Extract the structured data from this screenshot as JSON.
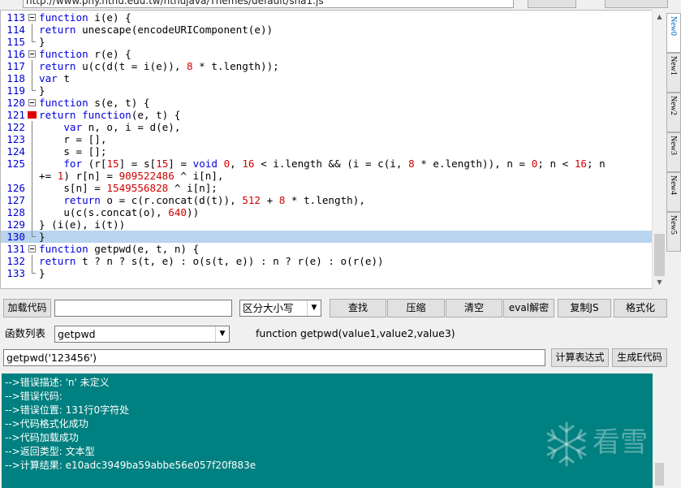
{
  "top": {
    "url": "http://www.phy.ntnu.edu.tw/ntnujava/Themes/default/sha1.js"
  },
  "editor": {
    "lines": [
      {
        "n": "113",
        "fold": "box",
        "html": "<span class=\"kw\">function</span> i(e) {"
      },
      {
        "n": "114",
        "fold": "line",
        "html": "<span class=\"kw\">return</span> unescape(encodeURIComponent(e))"
      },
      {
        "n": "115",
        "fold": "end",
        "html": "}"
      },
      {
        "n": "116",
        "fold": "box",
        "html": "<span class=\"kw\">function</span> r(e) {"
      },
      {
        "n": "117",
        "fold": "line",
        "html": "<span class=\"kw\">return</span> u(c(d(t = i(e)), <span class=\"num\">8</span> * t.length));"
      },
      {
        "n": "118",
        "fold": "line",
        "html": "<span class=\"kw\">var</span> t"
      },
      {
        "n": "119",
        "fold": "end",
        "html": "}"
      },
      {
        "n": "120",
        "fold": "box",
        "html": "<span class=\"kw\">function</span> s(e, t) {"
      },
      {
        "n": "121",
        "fold": "bookmark",
        "html": "<span class=\"kw\">return function</span>(e, t) {"
      },
      {
        "n": "122",
        "fold": "line",
        "html": "    <span class=\"kw\">var</span> n, o, i = d(e),"
      },
      {
        "n": "123",
        "fold": "line",
        "html": "    r = [],"
      },
      {
        "n": "124",
        "fold": "line",
        "html": "    s = [];"
      },
      {
        "n": "125",
        "fold": "line",
        "html": "    <span class=\"kw\">for</span> (r[<span class=\"num\">15</span>] = s[<span class=\"num\">15</span>] = <span class=\"kw\">void</span> <span class=\"num\">0</span>, <span class=\"num\">16</span> &lt; i.length &amp;&amp; (i = c(i, <span class=\"num\">8</span> * e.length)), n = <span class=\"num\">0</span>; n &lt; <span class=\"num\">16</span>; n"
      },
      {
        "n": "",
        "fold": "line",
        "html": "+= <span class=\"num\">1</span>) r[n] = <span class=\"num\">909522486</span> ^ i[n],"
      },
      {
        "n": "126",
        "fold": "line",
        "html": "    s[n] = <span class=\"num\">1549556828</span> ^ i[n];"
      },
      {
        "n": "127",
        "fold": "line",
        "html": "    <span class=\"kw\">return</span> o = c(r.concat(d(t)), <span class=\"num\">512</span> + <span class=\"num\">8</span> * t.length),"
      },
      {
        "n": "128",
        "fold": "line",
        "html": "    u(c(s.concat(o), <span class=\"num\">640</span>))"
      },
      {
        "n": "129",
        "fold": "line",
        "html": "} (i(e), i(t))"
      },
      {
        "n": "130",
        "fold": "end",
        "html": "}",
        "highlight": true
      },
      {
        "n": "131",
        "fold": "box",
        "html": "<span class=\"kw\">function</span> getpwd(e, t, n) {"
      },
      {
        "n": "132",
        "fold": "line",
        "html": "<span class=\"kw\">return</span> t ? n ? s(t, e) : o(s(t, e)) : n ? r(e) : o(r(e))"
      },
      {
        "n": "133",
        "fold": "end",
        "html": "}"
      }
    ]
  },
  "sidetabs": [
    "New0",
    "New1",
    "New2",
    "New3",
    "New4",
    "New5"
  ],
  "toolbar": {
    "load_code_label": "加载代码",
    "load_code_value": "",
    "case_select_value": "区分大小写",
    "find_label": "查找",
    "compress_label": "压缩",
    "clear_label": "清空",
    "eval_decode_label": "eval解密",
    "copy_js_label": "复制JS",
    "format_label": "格式化"
  },
  "functions": {
    "list_label": "函数列表",
    "selected": "getpwd",
    "signature": "function getpwd(value1,value2,value3)"
  },
  "expression": {
    "value": "getpwd('123456')",
    "calc_label": "计算表达式",
    "gen_e_label": "生成E代码"
  },
  "output": {
    "lines": [
      "-->错误描述: 'n' 未定义",
      "-->错误代码:",
      "-->错误位置: 131行0字符处",
      "-->代码格式化成功",
      "-->代码加载成功",
      "-->返回类型: 文本型",
      "-->计算结果: e10adc3949ba59abbe56e057f20f883e"
    ],
    "watermark": "看雪"
  },
  "colors": {
    "output_bg": "#008080",
    "keyword": "#0000e0",
    "number": "#d00000",
    "line_number": "#0000d0",
    "highlight": "#b8d4ee"
  }
}
